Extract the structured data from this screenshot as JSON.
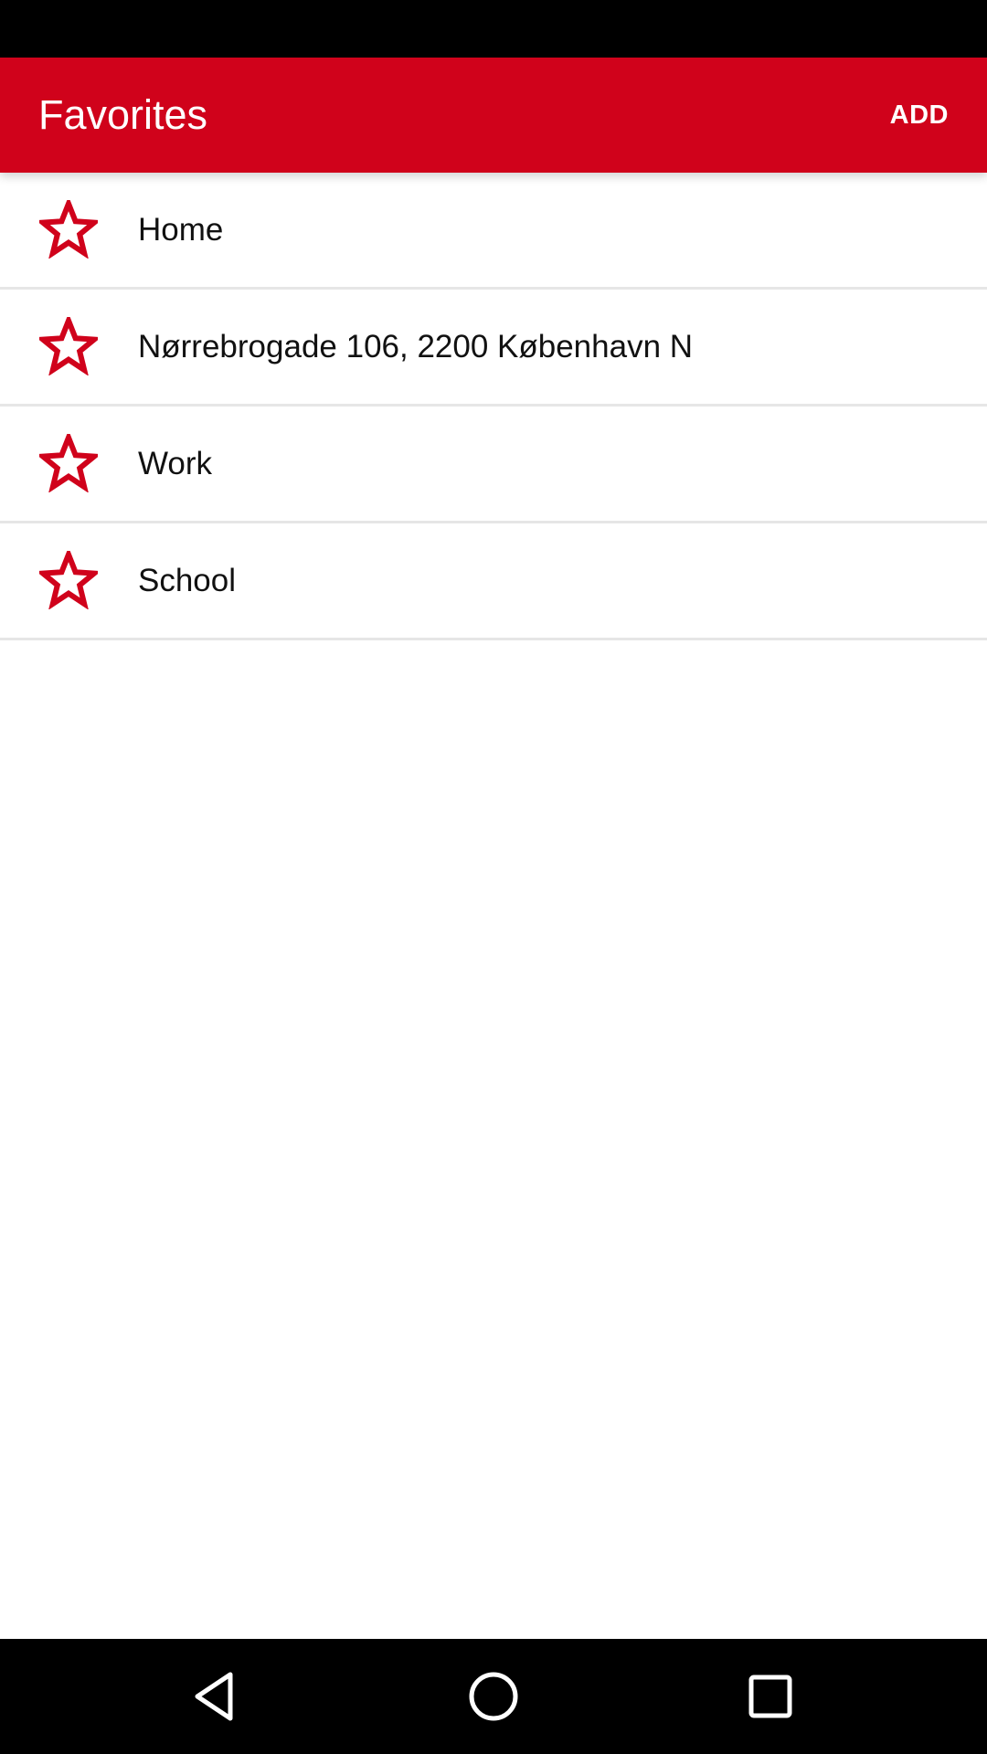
{
  "app_bar": {
    "title": "Favorites",
    "add_label": "ADD",
    "color": "#d0021b"
  },
  "favorites": [
    {
      "label": "Home",
      "icon": "star-outline-icon"
    },
    {
      "label": "Nørrebrogade 106, 2200 København N",
      "icon": "star-outline-icon"
    },
    {
      "label": "Work",
      "icon": "star-outline-icon"
    },
    {
      "label": "School",
      "icon": "star-outline-icon"
    }
  ],
  "navigation": {
    "buttons": [
      "back-icon",
      "home-icon",
      "recents-icon"
    ]
  }
}
